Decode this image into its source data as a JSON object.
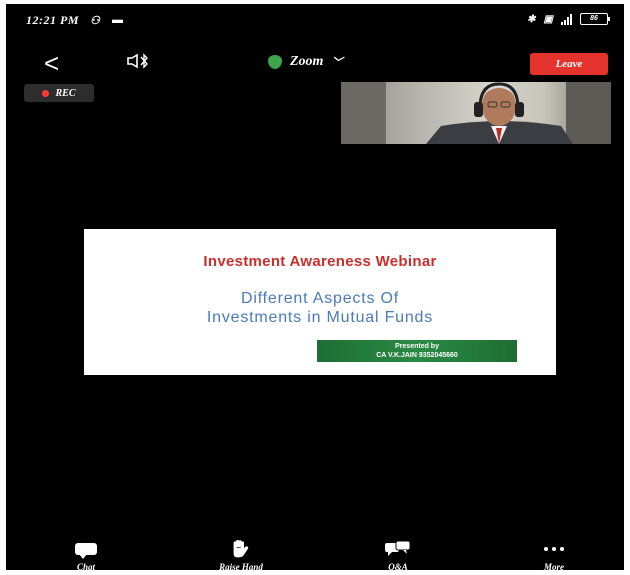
{
  "status_bar": {
    "time": "12:21 PM",
    "battery": "86"
  },
  "top_bar": {
    "back_symbol": "<",
    "meeting_name": "Zoom",
    "leave_label": "Leave"
  },
  "recording": {
    "label": "REC"
  },
  "slide": {
    "title": "Investment Awareness Webinar",
    "subtitle_line1": "Different Aspects Of",
    "subtitle_line2": "Investments in Mutual Funds",
    "presenter_line1": "Presented by",
    "presenter_line2": "CA V.K.JAIN 9352045660"
  },
  "toolbar": {
    "chat": "Chat",
    "raise_hand": "Raise Hand",
    "qa": "Q&A",
    "more": "More"
  },
  "colors": {
    "leave": "#e3332c",
    "slide_title": "#c9302c",
    "slide_subtitle": "#4a7bb7",
    "presenter_bg": "#2a8a44",
    "shield": "#3fa34d"
  },
  "icons": [
    "back-arrow-icon",
    "bluetooth-speaker-icon",
    "shield-icon",
    "chevron-down-icon",
    "chat-icon",
    "raise-hand-icon",
    "qa-icon",
    "more-icon"
  ]
}
